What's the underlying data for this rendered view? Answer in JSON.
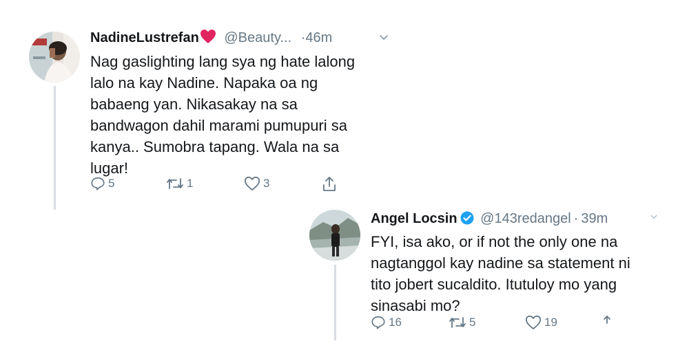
{
  "tweet1": {
    "display_name": "NadineLustrefan",
    "name_emoji": "red-heart",
    "handle": "@Beauty...",
    "separator": "·",
    "time": "46m",
    "text": "Nag gaslighting lang sya ng hate lalong\nlalo na kay Nadine. Napaka oa ng\nbabaeng yan. Nikasakay na sa\nbandwagon dahil marami pumupuri sa\nkanya.. Sumobra tapang. Wala na sa\nlugar!",
    "replies": "5",
    "retweets": "1",
    "likes": "3"
  },
  "tweet2": {
    "display_name": "Angel Locsin",
    "verified": true,
    "handle": "@143redangel",
    "separator": "·",
    "time": "39m",
    "text": "FYI, isa ako, or if not the only one na\nnagtanggol kay nadine sa statement ni\ntito jobert sucaldito. Itutuloy mo yang\nsinasabi mo?",
    "replies": "16",
    "retweets": "5",
    "likes": "19"
  },
  "icons": {
    "reply": "reply-icon",
    "retweet": "retweet-icon",
    "like": "heart-icon",
    "share": "share-icon",
    "more": "chevron-down-icon"
  },
  "colors": {
    "text": "#14171a",
    "secondary": "#657786",
    "verified": "#1da1f2",
    "heart_emoji": "#e0245e"
  }
}
